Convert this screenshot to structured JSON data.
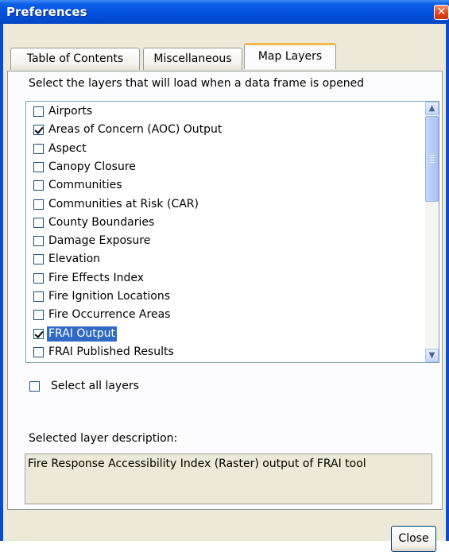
{
  "window": {
    "title": "Preferences",
    "close_glyph": "✕"
  },
  "tabs": [
    {
      "label": "Table of Contents",
      "active": false
    },
    {
      "label": "Miscellaneous",
      "active": false
    },
    {
      "label": "Map Layers",
      "active": true
    }
  ],
  "map_layers": {
    "instruction": "Select the layers that will load when a data frame is opened",
    "layers": [
      {
        "label": "Airports",
        "checked": false,
        "selected": false
      },
      {
        "label": "Areas of Concern (AOC) Output",
        "checked": true,
        "selected": false
      },
      {
        "label": "Aspect",
        "checked": false,
        "selected": false
      },
      {
        "label": "Canopy Closure",
        "checked": false,
        "selected": false
      },
      {
        "label": "Communities",
        "checked": false,
        "selected": false
      },
      {
        "label": "Communities at Risk (CAR)",
        "checked": false,
        "selected": false
      },
      {
        "label": "County Boundaries",
        "checked": false,
        "selected": false
      },
      {
        "label": "Damage Exposure",
        "checked": false,
        "selected": false
      },
      {
        "label": "Elevation",
        "checked": false,
        "selected": false
      },
      {
        "label": "Fire Effects Index",
        "checked": false,
        "selected": false
      },
      {
        "label": "Fire Ignition Locations",
        "checked": false,
        "selected": false
      },
      {
        "label": "Fire Occurrence Areas",
        "checked": false,
        "selected": false
      },
      {
        "label": "FRAI Output",
        "checked": true,
        "selected": true
      },
      {
        "label": "FRAI Published Results",
        "checked": false,
        "selected": false
      }
    ],
    "select_all_label": "Select all layers",
    "select_all_checked": false,
    "description_label": "Selected layer description:",
    "description_text": "Fire Response Accessibility Index (Raster) output of FRAI tool"
  },
  "footer": {
    "close_label": "Close"
  }
}
